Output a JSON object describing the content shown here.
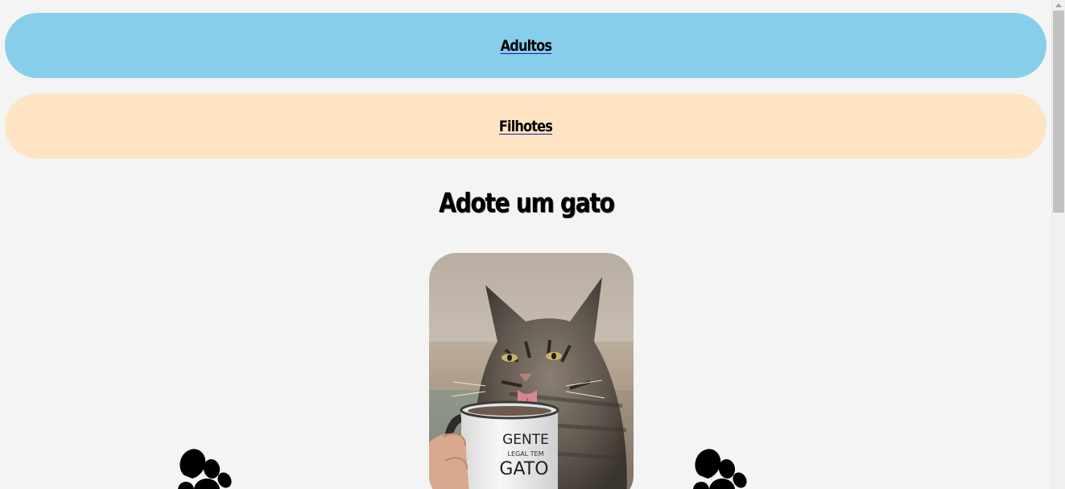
{
  "nav": {
    "items": [
      {
        "label": "Adultos",
        "color": "#87ceeb"
      },
      {
        "label": "Filhotes",
        "color": "#ffe4c4"
      }
    ]
  },
  "main": {
    "title": "Adote um gato",
    "photo": {
      "mug_text": [
        "GENTE",
        "LEGAL TEM",
        "GATO"
      ]
    },
    "icons": [
      "paw-icon",
      "paw-icon"
    ]
  },
  "colors": {
    "background": "#f4f4f4",
    "adultos_pill": "#87ceeb",
    "filhotes_pill": "#ffe4c4",
    "text": "#000000"
  }
}
